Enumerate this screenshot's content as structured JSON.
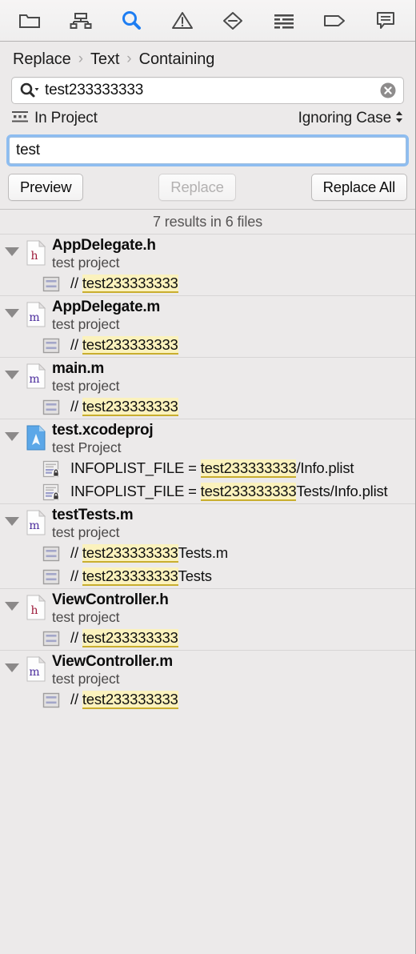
{
  "toolbar": {
    "items": [
      {
        "name": "project-navigator",
        "icon": "folder-icon",
        "active": false
      },
      {
        "name": "symbol-navigator",
        "icon": "hierarchy-icon",
        "active": false
      },
      {
        "name": "find-navigator",
        "icon": "search-icon",
        "active": true
      },
      {
        "name": "issue-navigator",
        "icon": "warning-triangle-icon",
        "active": false
      },
      {
        "name": "test-navigator",
        "icon": "minus-diamond-icon",
        "active": false
      },
      {
        "name": "debug-navigator",
        "icon": "list-lines-icon",
        "active": false
      },
      {
        "name": "breakpoint-navigator",
        "icon": "tag-icon",
        "active": false
      },
      {
        "name": "report-navigator",
        "icon": "speech-bubble-icon",
        "active": false
      }
    ],
    "accent_color": "#1d7df2"
  },
  "breadcrumb": {
    "items": [
      "Replace",
      "Text",
      "Containing"
    ],
    "separator": "›"
  },
  "search": {
    "value": "test233333333",
    "placeholder": "",
    "icon": "magnifier-dropdown-icon",
    "clear_icon": "clear-circle-icon"
  },
  "scope": {
    "icon": "in-project-icon",
    "label": "In Project",
    "case_option": "Ignoring Case",
    "case_icon": "updown-chevron-icon"
  },
  "replace": {
    "value": "test",
    "placeholder": "",
    "focused": true
  },
  "actions": {
    "preview": "Preview",
    "replace": "Replace",
    "replace_all": "Replace All",
    "replace_disabled": true
  },
  "results": {
    "summary": "7 results in 6 files",
    "groups": [
      {
        "file": "AppDelegate.h",
        "subtitle": "test project",
        "icon": "h-file-icon",
        "expanded": true,
        "matches": [
          {
            "icon": "text-lines-icon",
            "prefix": "// ",
            "highlight": "test233333333",
            "suffix": ""
          }
        ]
      },
      {
        "file": "AppDelegate.m",
        "subtitle": "test project",
        "icon": "m-file-icon",
        "expanded": true,
        "matches": [
          {
            "icon": "text-lines-icon",
            "prefix": "// ",
            "highlight": "test233333333",
            "suffix": ""
          }
        ]
      },
      {
        "file": "main.m",
        "subtitle": "test project",
        "icon": "m-file-icon",
        "expanded": true,
        "matches": [
          {
            "icon": "text-lines-icon",
            "prefix": "// ",
            "highlight": "test233333333",
            "suffix": ""
          }
        ]
      },
      {
        "file": "test.xcodeproj",
        "subtitle": "test Project",
        "icon": "xcodeproj-icon",
        "expanded": true,
        "matches": [
          {
            "icon": "locked-doc-icon",
            "prefix": "INFOPLIST_FILE = ",
            "highlight": "test233333333",
            "suffix": "/Info.plist"
          },
          {
            "icon": "locked-doc-icon",
            "prefix": "INFOPLIST_FILE = ",
            "highlight": "test233333333",
            "suffix": "Tests/Info.plist"
          }
        ]
      },
      {
        "file": "testTests.m",
        "subtitle": "test project",
        "icon": "m-file-icon",
        "expanded": true,
        "matches": [
          {
            "icon": "text-lines-icon",
            "prefix": "// ",
            "highlight": "test233333333",
            "suffix": "Tests.m"
          },
          {
            "icon": "text-lines-icon",
            "prefix": "// ",
            "highlight": "test233333333",
            "suffix": "Tests"
          }
        ]
      },
      {
        "file": "ViewController.h",
        "subtitle": "test project",
        "icon": "h-file-icon",
        "expanded": true,
        "matches": [
          {
            "icon": "text-lines-icon",
            "prefix": "// ",
            "highlight": "test233333333",
            "suffix": ""
          }
        ]
      },
      {
        "file": "ViewController.m",
        "subtitle": "test project",
        "icon": "m-file-icon",
        "expanded": true,
        "matches": [
          {
            "icon": "text-lines-icon",
            "prefix": "// ",
            "highlight": "test233333333",
            "suffix": ""
          }
        ]
      }
    ]
  },
  "colors": {
    "highlight_bg": "#fbf2bd",
    "highlight_underline": "#c9ae2e",
    "pane_bg": "#eceaea",
    "focus_ring": "#8ebdf0"
  }
}
